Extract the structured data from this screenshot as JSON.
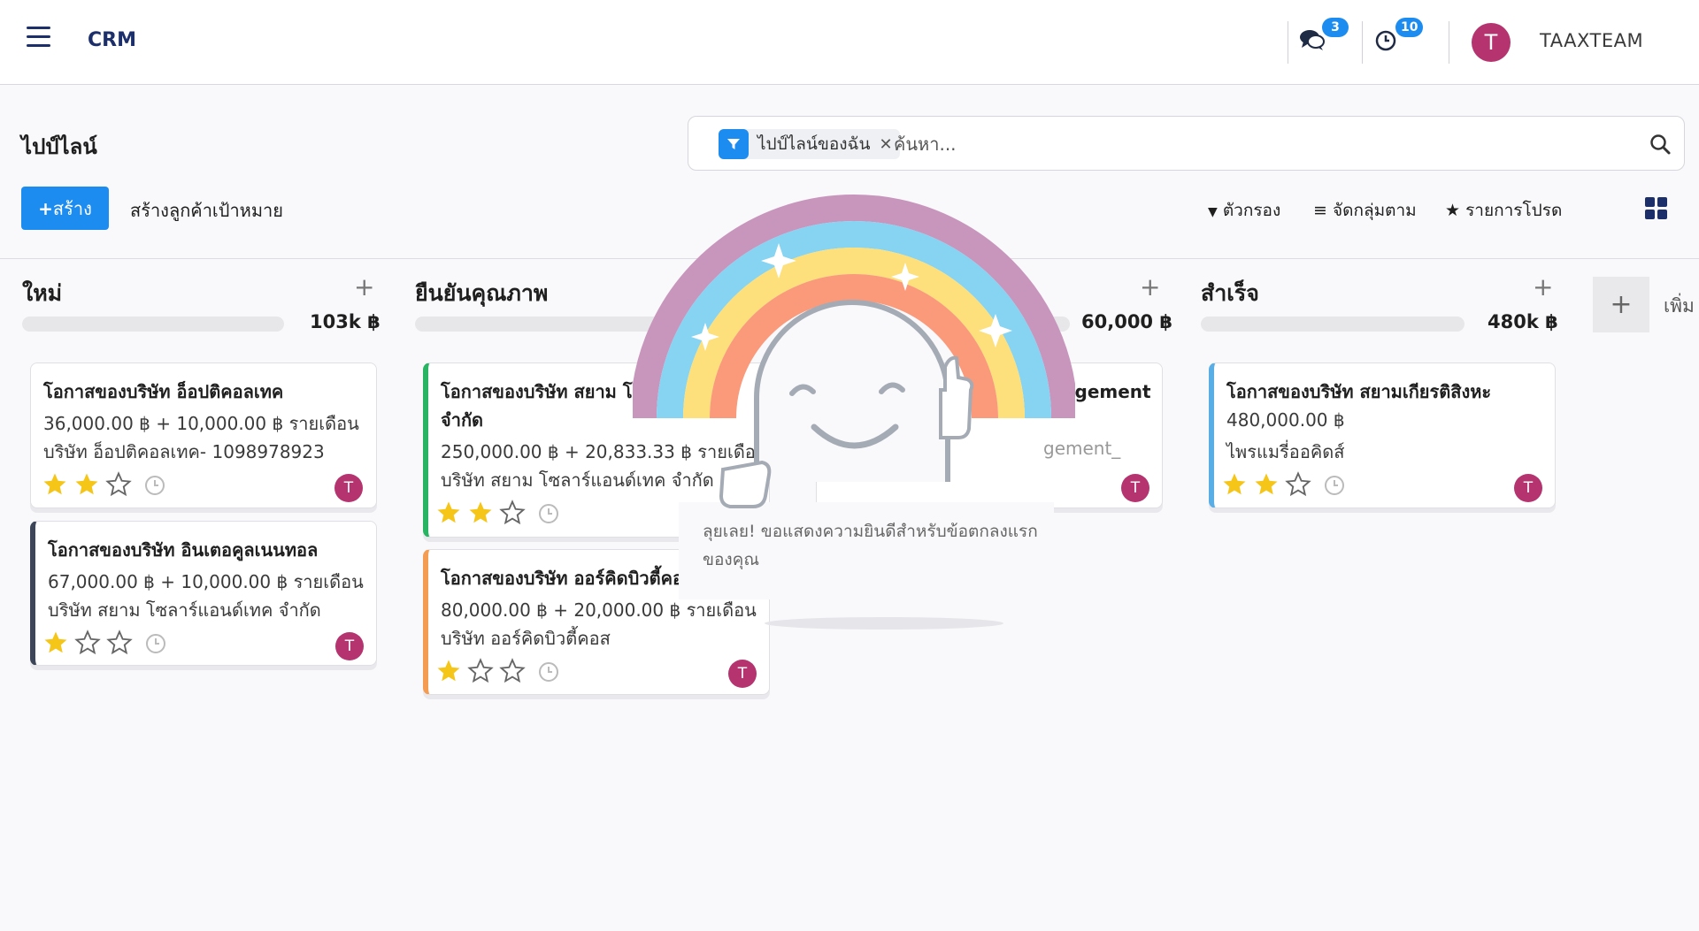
{
  "app": {
    "name": "CRM"
  },
  "navbar": {
    "messages_count": "3",
    "activities_count": "10",
    "user_initial": "T",
    "user_name": "TAAXTEAM"
  },
  "control_panel": {
    "title": "ไปป์ไลน์",
    "facet_label": "ไปป์ไลน์ของฉัน",
    "search_placeholder": "ค้นหา...",
    "create_label": "สร้าง",
    "generate_leads_label": "สร้างลูกค้าเป้าหมาย",
    "filters_label": "ตัวกรอง",
    "group_by_label": "จัดกลุ่มตาม",
    "favorites_label": "รายการโปรด"
  },
  "colors": {
    "accent": "#1c8cf0",
    "brand": "#1c2f6b",
    "avatar": "#b5336f",
    "star": "#f5c518"
  },
  "columns": [
    {
      "title": "ใหม่",
      "sum": "103k ฿",
      "cards": [
        {
          "title": "โอกาสของบริษัท อ็อปติคอลเทค",
          "amount": "36,000.00 ฿ + 10,000.00 ฿ รายเดือน",
          "company": "บริษัท อ็อปติคอลเทค- 1098978923",
          "stars": 2,
          "avatar": "T"
        },
        {
          "title": "โอกาสของบริษัท อินเตอคูลเนนทอล",
          "amount": "67,000.00 ฿ + 10,000.00 ฿ รายเดือน",
          "company": "บริษัท สยาม โซลาร์แอนด์เทค จำกัด",
          "stars": 1,
          "avatar": "T"
        }
      ]
    },
    {
      "title": "ยืนยันคุณภาพ",
      "cards": [
        {
          "title": "โอกาสของบริษัท สยาม โซล",
          "title2": "จำกัด",
          "amount": "250,000.00 ฿ + 20,833.33 ฿ รายเดือ",
          "company": "บริษัท สยาม โซลาร์แอนด์เทค จำกัด",
          "stars": 2
        },
        {
          "title": "โอกาสของบริษัท ออร์คิดบิวตี้คอ",
          "amount": "80,000.00 ฿ + 20,000.00 ฿ รายเดือน",
          "company": "บริษัท ออร์คิดบิวตี้คอส",
          "stars": 1,
          "avatar": "T"
        }
      ]
    },
    {
      "sum": "60,000 ฿",
      "cards": [
        {
          "title": "agement",
          "company": "gement_",
          "avatar": "T"
        }
      ]
    },
    {
      "title": "สำเร็จ",
      "sum": "480k ฿",
      "cards": [
        {
          "title": "โอกาสของบริษัท สยามเกียรติสิงหะ",
          "amount": "480,000.00 ฿",
          "company": "ไพรแมรี่ออคิดส์",
          "stars": 2,
          "avatar": "T"
        }
      ]
    }
  ],
  "add_column_label": "เพิ่ม",
  "rainbow": {
    "message": "ลุยเลย! ขอแสดงความยินดีสำหรับข้อตกลงแรกของคุณ"
  }
}
